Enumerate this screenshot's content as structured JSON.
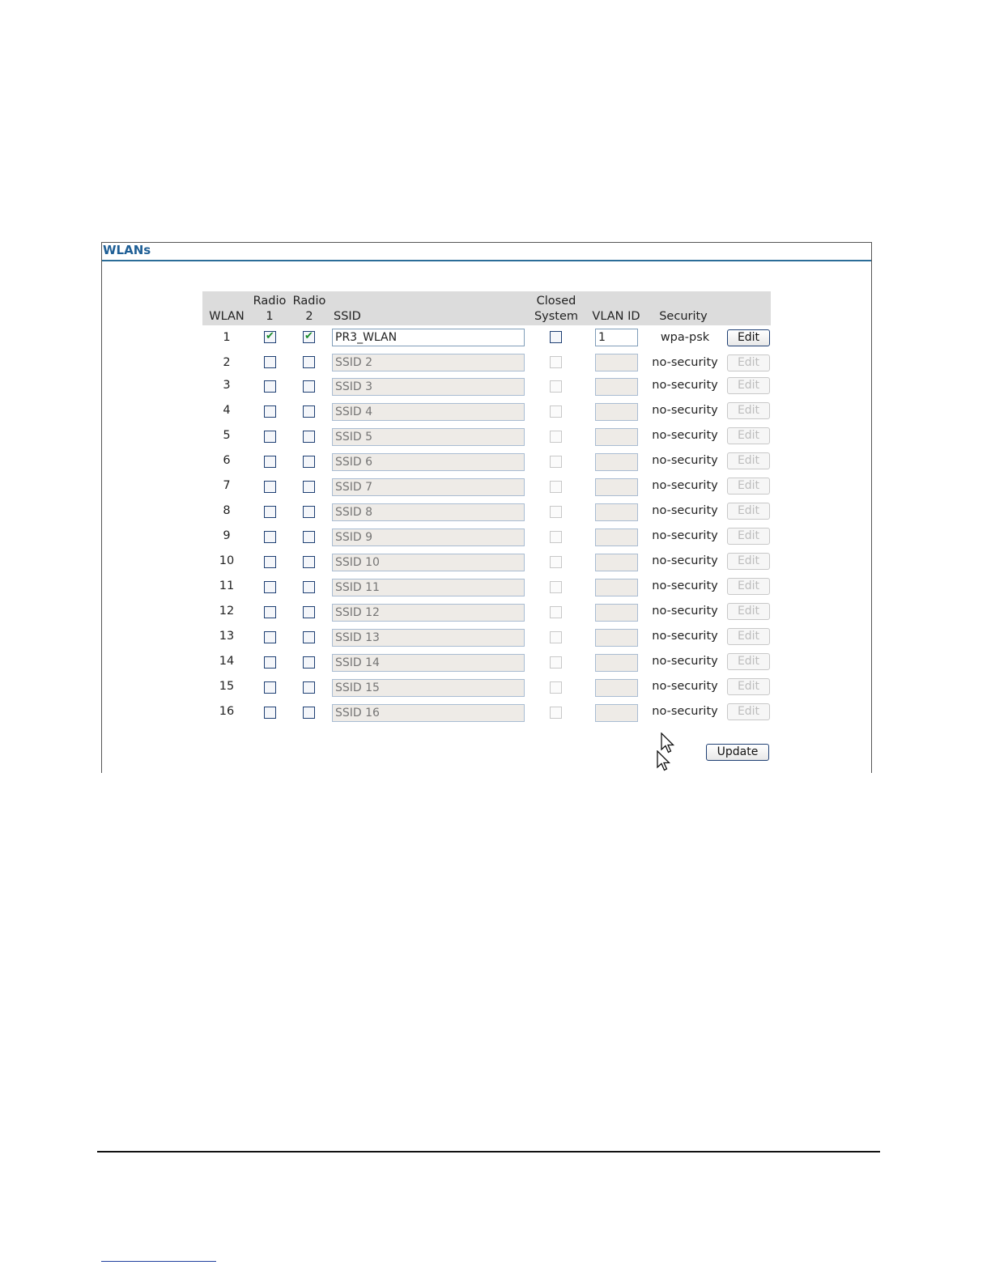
{
  "panel": {
    "title": "WLANs"
  },
  "headers": {
    "wlan": "WLAN",
    "radio1_line1": "Radio",
    "radio1_line2": "1",
    "radio2_line1": "Radio",
    "radio2_line2": "2",
    "ssid": "SSID",
    "closed_line1": "Closed",
    "closed_line2": "System",
    "vlan_id": "VLAN ID",
    "security": "Security"
  },
  "rows": [
    {
      "wlan": "1",
      "radio1": true,
      "radio2": true,
      "ssid": "PR3_WLAN",
      "ssid_placeholder": "",
      "closed_system": false,
      "vlan_id": "1",
      "security": "wpa-psk",
      "edit_label": "Edit",
      "enabled": true
    },
    {
      "wlan": "2",
      "radio1": false,
      "radio2": false,
      "ssid": "",
      "ssid_placeholder": "SSID 2",
      "closed_system": false,
      "vlan_id": "",
      "security": "no-security",
      "edit_label": "Edit",
      "enabled": false
    },
    {
      "wlan": "3",
      "radio1": false,
      "radio2": false,
      "ssid": "",
      "ssid_placeholder": "SSID 3",
      "closed_system": false,
      "vlan_id": "",
      "security": "no-security",
      "edit_label": "Edit",
      "enabled": false
    },
    {
      "wlan": "4",
      "radio1": false,
      "radio2": false,
      "ssid": "",
      "ssid_placeholder": "SSID 4",
      "closed_system": false,
      "vlan_id": "",
      "security": "no-security",
      "edit_label": "Edit",
      "enabled": false
    },
    {
      "wlan": "5",
      "radio1": false,
      "radio2": false,
      "ssid": "",
      "ssid_placeholder": "SSID 5",
      "closed_system": false,
      "vlan_id": "",
      "security": "no-security",
      "edit_label": "Edit",
      "enabled": false
    },
    {
      "wlan": "6",
      "radio1": false,
      "radio2": false,
      "ssid": "",
      "ssid_placeholder": "SSID 6",
      "closed_system": false,
      "vlan_id": "",
      "security": "no-security",
      "edit_label": "Edit",
      "enabled": false
    },
    {
      "wlan": "7",
      "radio1": false,
      "radio2": false,
      "ssid": "",
      "ssid_placeholder": "SSID 7",
      "closed_system": false,
      "vlan_id": "",
      "security": "no-security",
      "edit_label": "Edit",
      "enabled": false
    },
    {
      "wlan": "8",
      "radio1": false,
      "radio2": false,
      "ssid": "",
      "ssid_placeholder": "SSID 8",
      "closed_system": false,
      "vlan_id": "",
      "security": "no-security",
      "edit_label": "Edit",
      "enabled": false
    },
    {
      "wlan": "9",
      "radio1": false,
      "radio2": false,
      "ssid": "",
      "ssid_placeholder": "SSID 9",
      "closed_system": false,
      "vlan_id": "",
      "security": "no-security",
      "edit_label": "Edit",
      "enabled": false
    },
    {
      "wlan": "10",
      "radio1": false,
      "radio2": false,
      "ssid": "",
      "ssid_placeholder": "SSID 10",
      "closed_system": false,
      "vlan_id": "",
      "security": "no-security",
      "edit_label": "Edit",
      "enabled": false
    },
    {
      "wlan": "11",
      "radio1": false,
      "radio2": false,
      "ssid": "",
      "ssid_placeholder": "SSID 11",
      "closed_system": false,
      "vlan_id": "",
      "security": "no-security",
      "edit_label": "Edit",
      "enabled": false
    },
    {
      "wlan": "12",
      "radio1": false,
      "radio2": false,
      "ssid": "",
      "ssid_placeholder": "SSID 12",
      "closed_system": false,
      "vlan_id": "",
      "security": "no-security",
      "edit_label": "Edit",
      "enabled": false
    },
    {
      "wlan": "13",
      "radio1": false,
      "radio2": false,
      "ssid": "",
      "ssid_placeholder": "SSID 13",
      "closed_system": false,
      "vlan_id": "",
      "security": "no-security",
      "edit_label": "Edit",
      "enabled": false
    },
    {
      "wlan": "14",
      "radio1": false,
      "radio2": false,
      "ssid": "",
      "ssid_placeholder": "SSID 14",
      "closed_system": false,
      "vlan_id": "",
      "security": "no-security",
      "edit_label": "Edit",
      "enabled": false
    },
    {
      "wlan": "15",
      "radio1": false,
      "radio2": false,
      "ssid": "",
      "ssid_placeholder": "SSID 15",
      "closed_system": false,
      "vlan_id": "",
      "security": "no-security",
      "edit_label": "Edit",
      "enabled": false
    },
    {
      "wlan": "16",
      "radio1": false,
      "radio2": false,
      "ssid": "",
      "ssid_placeholder": "SSID 16",
      "closed_system": false,
      "vlan_id": "",
      "security": "no-security",
      "edit_label": "Edit",
      "enabled": false
    }
  ],
  "update_label": "Update",
  "icons": {
    "cursor": "mouse-pointer-icon",
    "checkmark": "check-icon"
  },
  "colors": {
    "title": "#1f5f96",
    "header_bg": "#dcdcdc",
    "check": "#1a8a2a"
  }
}
